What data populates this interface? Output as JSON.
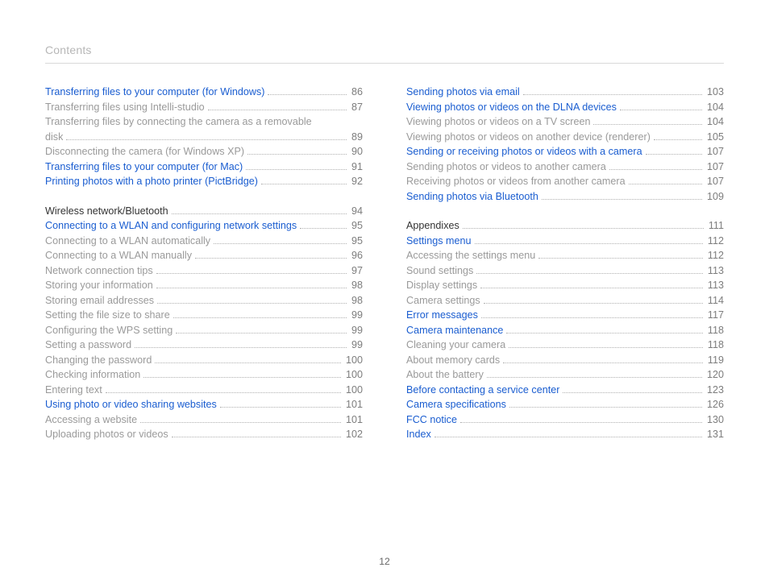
{
  "header": "Contents",
  "page_number": "12",
  "columns": [
    {
      "items": [
        {
          "label": "Transferring files to your computer (for Windows)",
          "page": "86",
          "type": "link"
        },
        {
          "label": "Transferring files using Intelli-studio",
          "page": "87",
          "type": "sub"
        },
        {
          "label": "Transferring files by connecting the camera as a removable",
          "type": "sub",
          "nopage": true
        },
        {
          "label": "disk",
          "page": "89",
          "type": "sub"
        },
        {
          "label": "Disconnecting the camera (for Windows XP)",
          "page": "90",
          "type": "sub"
        },
        {
          "label": "Transferring files to your computer (for Mac)",
          "page": "91",
          "type": "link"
        },
        {
          "label": "Printing photos with a photo printer (PictBridge)",
          "page": "92",
          "type": "link"
        },
        {
          "type": "spacer"
        },
        {
          "label": "Wireless network/Bluetooth",
          "page": "94",
          "type": "section"
        },
        {
          "label": "Connecting to a WLAN and configuring network settings",
          "page": "95",
          "type": "link"
        },
        {
          "label": "Connecting to a WLAN automatically",
          "page": "95",
          "type": "sub"
        },
        {
          "label": "Connecting to a WLAN manually",
          "page": "96",
          "type": "sub"
        },
        {
          "label": "Network connection tips",
          "page": "97",
          "type": "sub"
        },
        {
          "label": "Storing your information",
          "page": "98",
          "type": "sub"
        },
        {
          "label": "Storing email addresses",
          "page": "98",
          "type": "sub"
        },
        {
          "label": "Setting the file size to share",
          "page": "99",
          "type": "sub"
        },
        {
          "label": "Configuring the WPS setting",
          "page": "99",
          "type": "sub"
        },
        {
          "label": "Setting a password",
          "page": "99",
          "type": "sub"
        },
        {
          "label": "Changing the password",
          "page": "100",
          "type": "sub"
        },
        {
          "label": "Checking information",
          "page": "100",
          "type": "sub"
        },
        {
          "label": "Entering text",
          "page": "100",
          "type": "sub"
        },
        {
          "label": "Using photo or video sharing websites",
          "page": "101",
          "type": "link"
        },
        {
          "label": "Accessing a website",
          "page": "101",
          "type": "sub"
        },
        {
          "label": "Uploading photos or videos",
          "page": "102",
          "type": "sub"
        }
      ]
    },
    {
      "items": [
        {
          "label": "Sending photos via email",
          "page": "103",
          "type": "link"
        },
        {
          "label": "Viewing photos or videos on the DLNA devices",
          "page": "104",
          "type": "link"
        },
        {
          "label": "Viewing photos or videos on a TV screen",
          "page": "104",
          "type": "sub"
        },
        {
          "label": "Viewing photos or videos on another device (renderer)",
          "page": "105",
          "type": "sub"
        },
        {
          "label": "Sending or receiving photos or videos with a camera",
          "page": "107",
          "type": "link"
        },
        {
          "label": "Sending photos or videos to another camera",
          "page": "107",
          "type": "sub"
        },
        {
          "label": "Receiving photos or videos from another camera",
          "page": "107",
          "type": "sub"
        },
        {
          "label": "Sending photos via Bluetooth",
          "page": "109",
          "type": "link"
        },
        {
          "type": "spacer"
        },
        {
          "label": "Appendixes",
          "page": "111",
          "type": "section"
        },
        {
          "label": "Settings menu",
          "page": "112",
          "type": "link"
        },
        {
          "label": "Accessing the settings menu",
          "page": "112",
          "type": "sub"
        },
        {
          "label": "Sound settings",
          "page": "113",
          "type": "sub"
        },
        {
          "label": "Display settings",
          "page": "113",
          "type": "sub"
        },
        {
          "label": "Camera settings",
          "page": "114",
          "type": "sub"
        },
        {
          "label": "Error messages",
          "page": "117",
          "type": "link"
        },
        {
          "label": "Camera maintenance",
          "page": "118",
          "type": "link"
        },
        {
          "label": "Cleaning your camera",
          "page": "118",
          "type": "sub"
        },
        {
          "label": "About memory cards",
          "page": "119",
          "type": "sub"
        },
        {
          "label": "About the battery",
          "page": "120",
          "type": "sub"
        },
        {
          "label": "Before contacting a service center",
          "page": "123",
          "type": "link"
        },
        {
          "label": "Camera specifications",
          "page": "126",
          "type": "link"
        },
        {
          "label": "FCC notice",
          "page": "130",
          "type": "link"
        },
        {
          "label": "Index",
          "page": "131",
          "type": "link"
        }
      ]
    }
  ]
}
